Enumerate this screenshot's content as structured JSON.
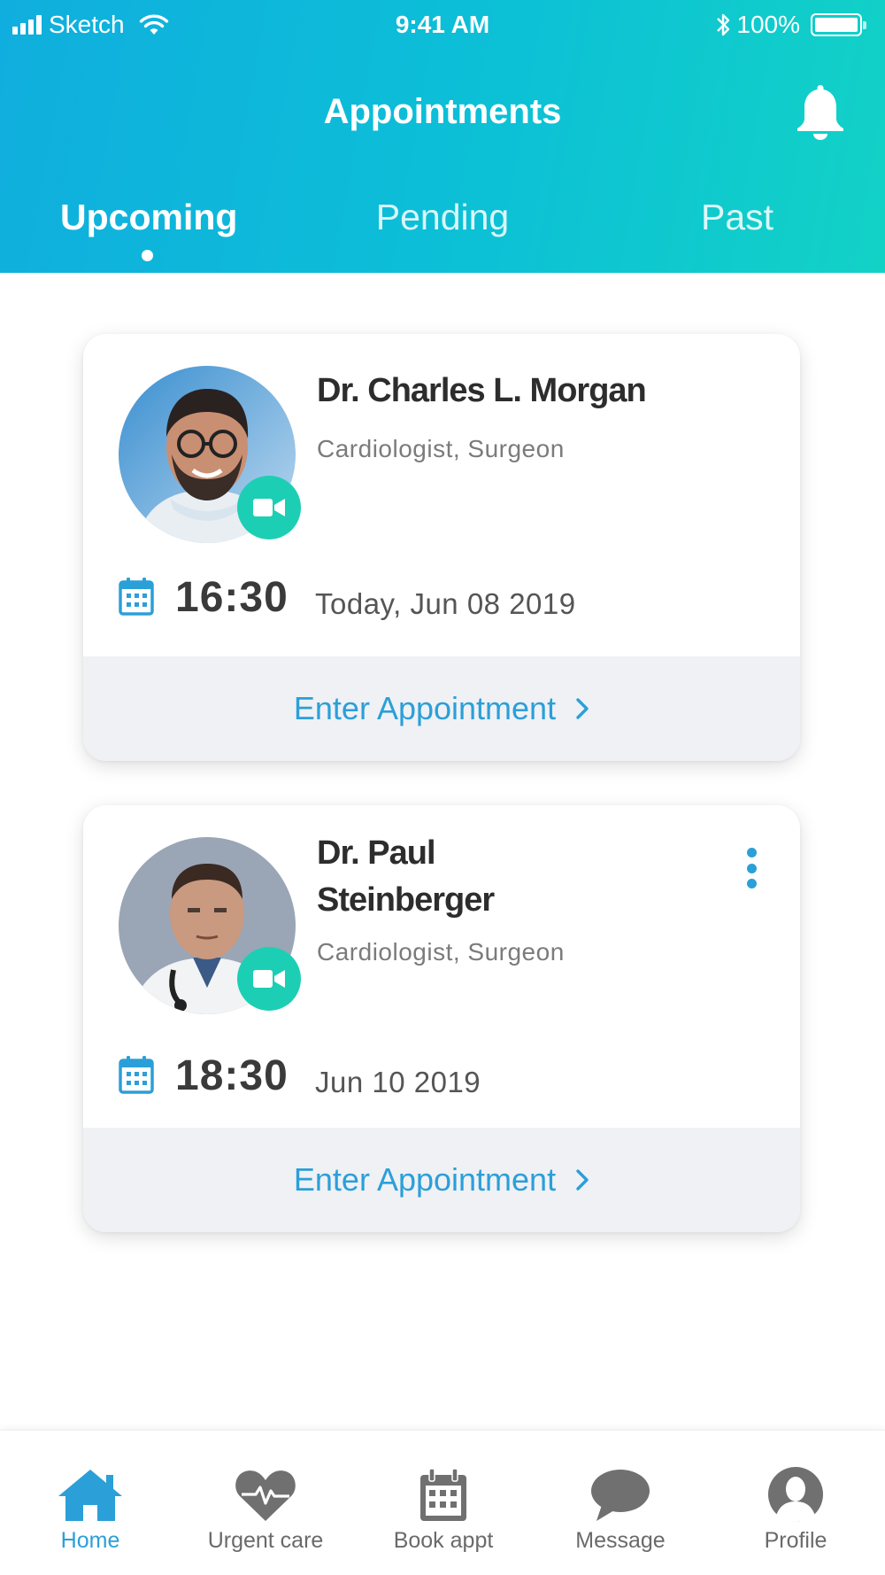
{
  "status_bar": {
    "carrier": "Sketch",
    "time": "9:41 AM",
    "battery": "100%"
  },
  "header": {
    "title": "Appointments",
    "tabs": [
      {
        "label": "Upcoming",
        "active": true
      },
      {
        "label": "Pending",
        "active": false
      },
      {
        "label": "Past",
        "active": false
      }
    ]
  },
  "appointments": [
    {
      "doctor_name": "Dr. Charles L. Morgan",
      "specialty": "Cardiologist, Surgeon",
      "time": "16:30",
      "date": "Today, Jun 08 2019",
      "action": "Enter Appointment"
    },
    {
      "doctor_name_line1": "Dr. Paul",
      "doctor_name_line2": "Steinberger",
      "specialty": "Cardiologist, Surgeon",
      "time": "18:30",
      "date": "Jun 10 2019",
      "action": "Enter Appointment"
    }
  ],
  "bottom_nav": [
    {
      "label": "Home",
      "icon": "home-icon",
      "active": true
    },
    {
      "label": "Urgent care",
      "icon": "heart-pulse-icon",
      "active": false
    },
    {
      "label": "Book appt",
      "icon": "calendar-icon",
      "active": false
    },
    {
      "label": "Message",
      "icon": "chat-bubble-icon",
      "active": false
    },
    {
      "label": "Profile",
      "icon": "profile-icon",
      "active": false
    }
  ],
  "colors": {
    "accent": "#2b9fd8",
    "header_gradient_start": "#10aede",
    "header_gradient_end": "#12d2c6",
    "video_badge": "#1ccfb4",
    "inactive_icon": "#707070"
  }
}
